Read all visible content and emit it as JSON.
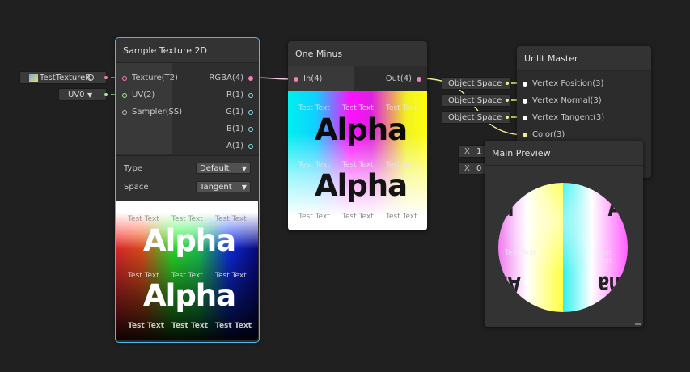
{
  "nodes": {
    "sample": {
      "title": "Sample Texture 2D",
      "inputs": [
        "Texture(T2)",
        "UV(2)",
        "Sampler(SS)"
      ],
      "outputs": [
        "RGBA(4)",
        "R(1)",
        "G(1)",
        "B(1)",
        "A(1)"
      ],
      "type_label": "Type",
      "type_value": "Default",
      "space_label": "Space",
      "space_value": "Tangent"
    },
    "one_minus": {
      "title": "One Minus",
      "input": "In(4)",
      "output": "Out(4)"
    },
    "unlit": {
      "title": "Unlit Master",
      "inputs": [
        "Vertex Position(3)",
        "Vertex Normal(3)",
        "Vertex Tangent(3)",
        "Color(3)"
      ]
    },
    "main_preview": {
      "title": "Main Preview"
    }
  },
  "property_chips": {
    "texture": "TestTextureR",
    "uv": "UV0"
  },
  "space_chips": [
    "Object Space",
    "Object Space",
    "Object Space"
  ],
  "vector_fields": [
    {
      "axis": "X",
      "value": "1"
    },
    {
      "axis": "X",
      "value": "0"
    }
  ],
  "preview_text": {
    "word": "Alpha",
    "small": "Test Text"
  },
  "colors": {
    "background": "#202020",
    "selection": "#4bb8ec",
    "port_pink": "#f27db9",
    "port_green": "#9ff28a",
    "port_cyan": "#84e4f0",
    "port_yellow": "#f0ee8c"
  }
}
